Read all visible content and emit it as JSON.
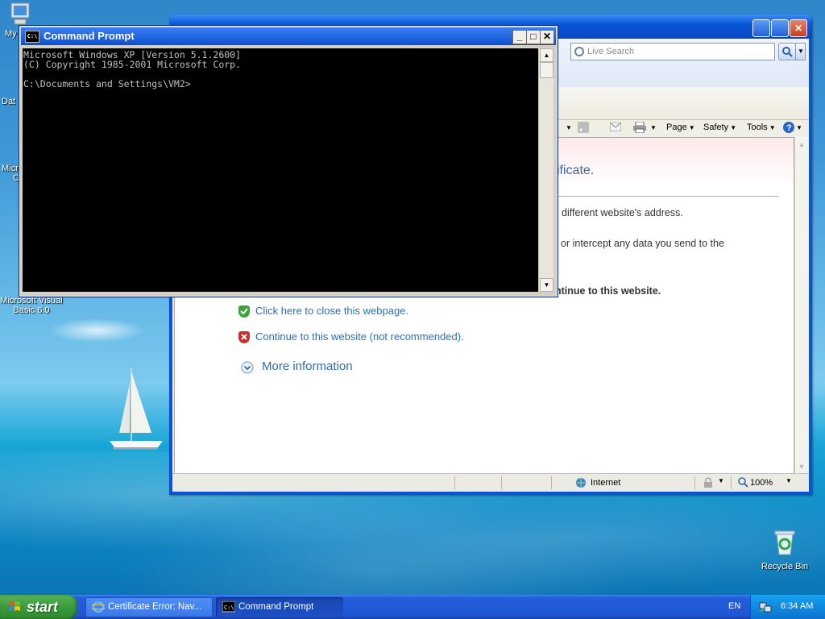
{
  "desktop": {
    "icons": [
      {
        "label": "My",
        "icon": "my-computer-icon"
      },
      {
        "label": "Dat",
        "icon": "database-icon"
      },
      {
        "label": "Micr",
        "label2": "C",
        "icon": "app-icon"
      },
      {
        "label": "Microsoft Visual",
        "label2": "Basic 6.0",
        "icon": "vb6-icon"
      },
      {
        "label": "Recycle Bin",
        "icon": "recycle-bin-icon"
      }
    ]
  },
  "ie": {
    "search_placeholder": "Live Search",
    "commands": [
      {
        "label": "Page",
        "icon": "page-icon"
      },
      {
        "label": "Safety",
        "icon": "safety-icon"
      },
      {
        "label": "Tools",
        "icon": "tools-icon"
      }
    ],
    "page": {
      "heading_fragment": "ificate.",
      "line1": "different website's address.",
      "line2": "or intercept any data you send to the",
      "line3_bold": "ntinue to this website.",
      "close_link": "Click here to close this webpage.",
      "continue_link": "Continue to this website (not recommended).",
      "more_info": "More information"
    },
    "status": {
      "zone": "Internet",
      "zoom": "100%"
    }
  },
  "cmd": {
    "title": "Command Prompt",
    "lines": [
      "Microsoft Windows XP [Version 5.1.2600]",
      "(C) Copyright 1985-2001 Microsoft Corp.",
      "",
      "C:\\Documents and Settings\\VM2>"
    ],
    "icon_text": "C:\\"
  },
  "taskbar": {
    "start_label": "start",
    "tasks": [
      {
        "label": "Certificate Error: Nav...",
        "active": false
      },
      {
        "label": "Command Prompt",
        "active": true
      }
    ],
    "language": "EN",
    "clock": "6:34 AM"
  },
  "colors": {
    "xp_blue": "#0b53d6",
    "link": "#2a6fb1",
    "start_green": "#3a9a3c"
  }
}
